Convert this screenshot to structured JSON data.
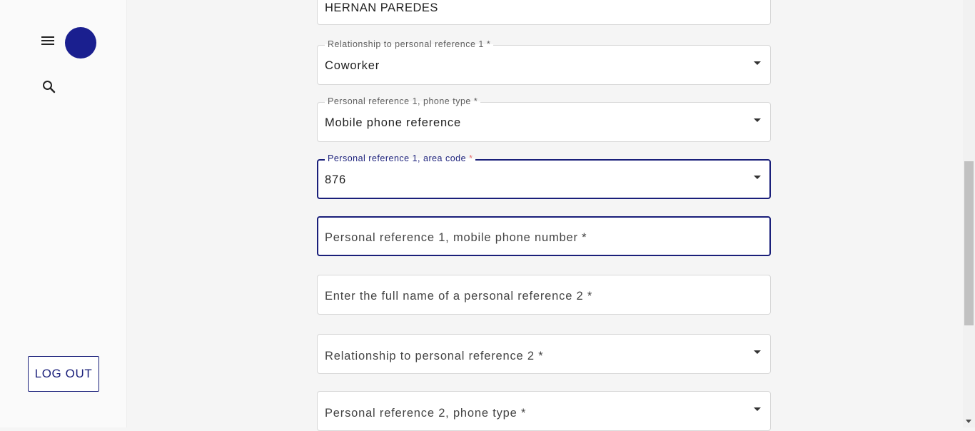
{
  "sidebar": {
    "logout_label": "LOG OUT"
  },
  "form": {
    "fields": [
      {
        "label": "",
        "value": "HERNAN PAREDES",
        "placeholder": "",
        "type": "text"
      },
      {
        "label": "Relationship to personal reference 1",
        "required": "*",
        "value": "Coworker",
        "type": "select"
      },
      {
        "label": "Personal reference 1, phone type",
        "required": "*",
        "value": "Mobile phone reference",
        "type": "select"
      },
      {
        "label": "Personal reference 1, area code",
        "required": "*",
        "value": "876",
        "type": "select"
      },
      {
        "placeholder": "Personal reference 1, mobile phone number *",
        "value": "",
        "type": "text"
      },
      {
        "placeholder": "Enter the full name of a personal reference 2 *",
        "value": "",
        "type": "text"
      },
      {
        "placeholder": "Relationship to personal reference 2 *",
        "value": "",
        "type": "select"
      },
      {
        "placeholder": "Personal reference 2, phone type *",
        "value": "",
        "type": "select"
      }
    ]
  },
  "colors": {
    "accent": "#1a1f7a",
    "avatar": "#1a1f8f",
    "required_focused": "#e57373"
  }
}
